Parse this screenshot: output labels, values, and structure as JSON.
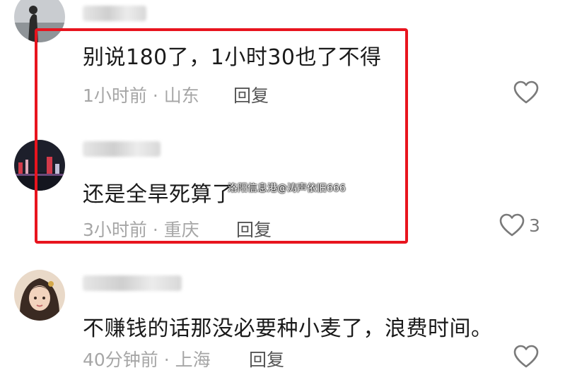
{
  "comments": [
    {
      "text": "别说180了，1小时30也了不得",
      "time": "1小时前",
      "location": "山东",
      "reply_label": "回复",
      "like_count": ""
    },
    {
      "text": "还是全旱死算了",
      "time": "3小时前",
      "location": "重庆",
      "reply_label": "回复",
      "like_count": "3"
    },
    {
      "text": "不赚钱的话那没必要种小麦了，浪费时间。",
      "time": "40分钟前",
      "location": "上海",
      "reply_label": "回复",
      "like_count": ""
    }
  ],
  "meta_separator": "·",
  "watermark": "洛阳信息港@涛声依旧666",
  "colors": {
    "highlight_border": "#e8141e",
    "text": "#1a1a1a",
    "meta": "#a6a6a6",
    "reply": "#555555",
    "like_icon": "#7a7a7a"
  },
  "icons": {
    "like": "heart-outline-icon"
  }
}
